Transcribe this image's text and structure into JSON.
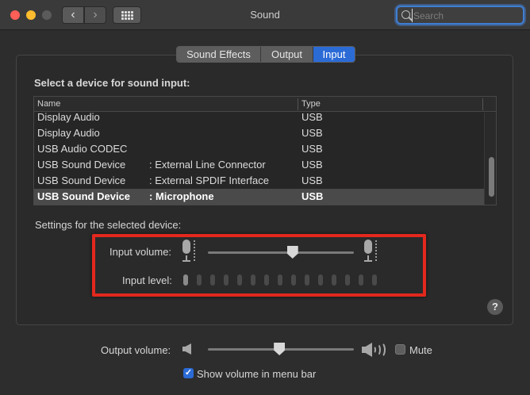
{
  "window": {
    "title": "Sound"
  },
  "toolbar": {
    "back_glyph": "‹",
    "forward_glyph": "›",
    "search_placeholder": "Search",
    "search_value": ""
  },
  "tabs": [
    {
      "label": "Sound Effects",
      "selected": false
    },
    {
      "label": "Output",
      "selected": false
    },
    {
      "label": "Input",
      "selected": true
    }
  ],
  "input_tab": {
    "section_title": "Select a device for sound input:",
    "columns": {
      "name": "Name",
      "type": "Type"
    },
    "devices": [
      {
        "name": "Display Audio",
        "port": "",
        "type": "USB",
        "selected": false
      },
      {
        "name": "Display Audio",
        "port": "",
        "type": "USB",
        "selected": false
      },
      {
        "name": "USB Audio CODEC",
        "port": "",
        "type": "USB",
        "selected": false
      },
      {
        "name": "USB Sound Device",
        "port": ": External Line Connector",
        "type": "USB",
        "selected": false
      },
      {
        "name": "USB Sound Device",
        "port": ": External SPDIF Interface",
        "type": "USB",
        "selected": false
      },
      {
        "name": "USB Sound Device",
        "port": ": Microphone",
        "type": "USB",
        "selected": true
      }
    ],
    "settings_label": "Settings for the selected device:",
    "input_volume_label": "Input volume:",
    "input_volume_value": 0.58,
    "input_level_label": "Input level:",
    "input_level_segments": 15,
    "input_level_active": 1
  },
  "help_label": "?",
  "output": {
    "volume_label": "Output volume:",
    "volume_value": 0.49,
    "mute_label": "Mute",
    "mute_checked": false,
    "show_in_menu_label": "Show volume in menu bar",
    "show_in_menu_checked": true
  },
  "colors": {
    "accent": "#2b6bd6",
    "highlight_annotation": "#e3281e"
  }
}
